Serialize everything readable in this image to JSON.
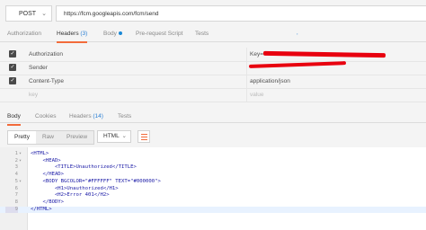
{
  "request": {
    "method": "POST",
    "url": "https://fcm.googleapis.com/fcm/send",
    "tabs": [
      {
        "label": "Authorization",
        "count": ""
      },
      {
        "label": "Headers",
        "count": "(3)"
      },
      {
        "label": "Body",
        "count": ""
      },
      {
        "label": "Pre-request Script",
        "count": ""
      },
      {
        "label": "Tests",
        "count": ""
      }
    ]
  },
  "headers": [
    {
      "key": "Authorization",
      "value": "Key="
    },
    {
      "key": "Sender",
      "value": ""
    },
    {
      "key": "Content-Type",
      "value": "application/json"
    }
  ],
  "new_row": {
    "key_placeholder": "key",
    "value_placeholder": "value"
  },
  "response": {
    "tabs": [
      {
        "label": "Body",
        "count": ""
      },
      {
        "label": "Cookies",
        "count": ""
      },
      {
        "label": "Headers",
        "count": "(14)"
      },
      {
        "label": "Tests",
        "count": ""
      }
    ],
    "view_modes": [
      "Pretty",
      "Raw",
      "Preview"
    ],
    "format": "HTML",
    "code_lines": [
      "<HTML>",
      "    <HEAD>",
      "        <TITLE>Unauthorized</TITLE>",
      "    </HEAD>",
      "    <BODY BGCOLOR=\"#FFFFFF\" TEXT=\"#000000\">",
      "        <H1>Unauthorized</H1>",
      "        <H2>Error 401</H2>",
      "    </BODY>",
      "</HTML>"
    ]
  },
  "colors": {
    "accent": "#f26b3a",
    "redaction": "#e8000f",
    "link": "#2a7fd4"
  }
}
